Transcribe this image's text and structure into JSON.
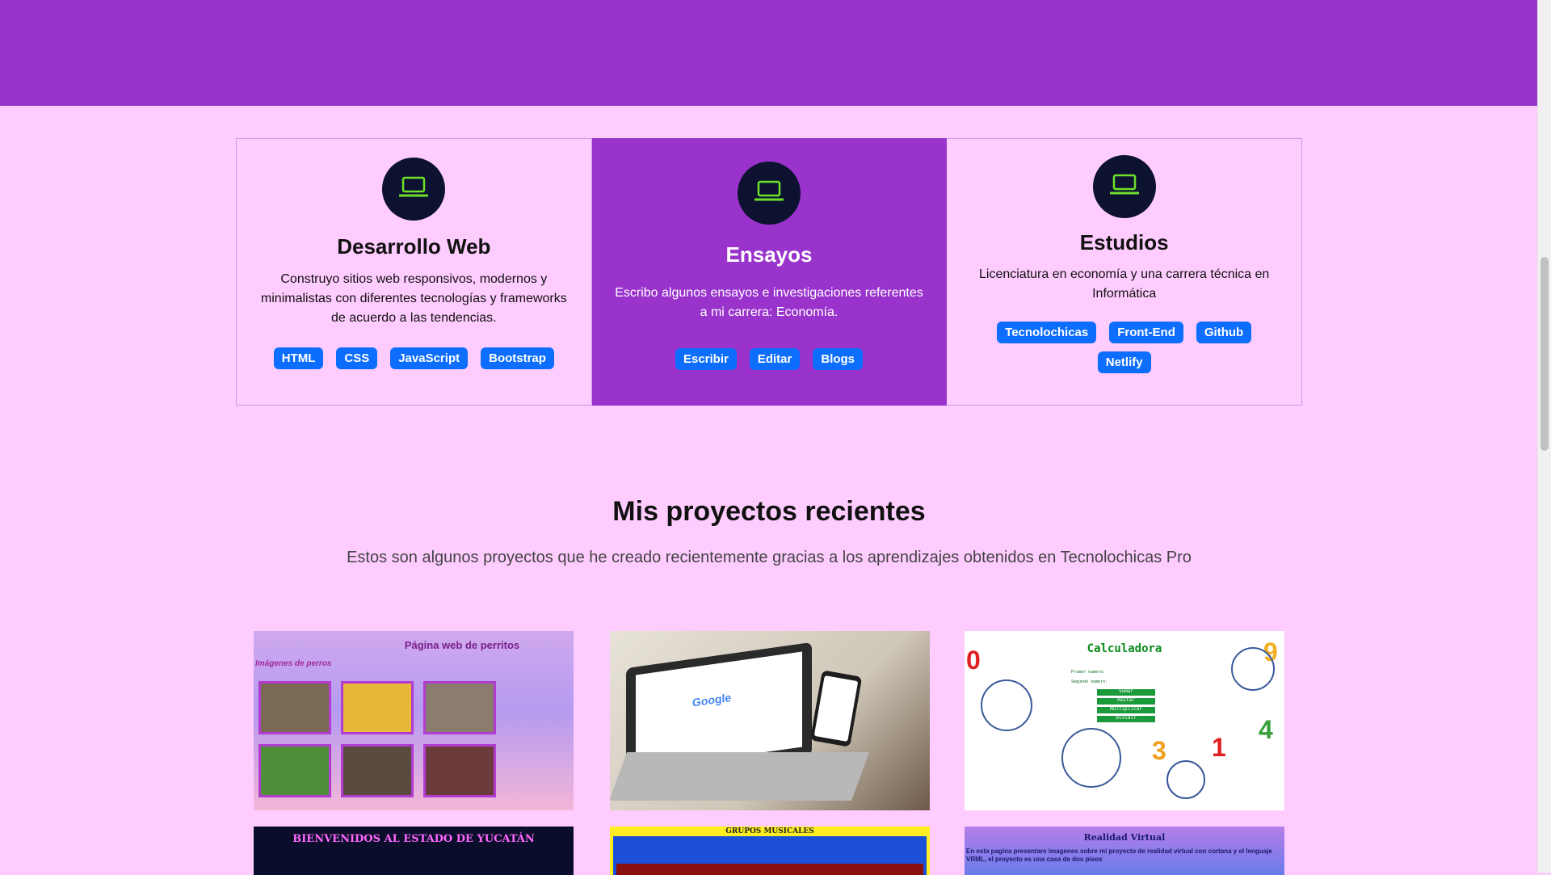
{
  "colors": {
    "accent": "#9933cc",
    "background": "#ffccff",
    "badge": "#0d6efd",
    "icon_circle": "#0c1230",
    "icon_stroke": "#6ee02a"
  },
  "services": [
    {
      "icon": "laptop-icon",
      "title": "Desarrollo Web",
      "description": "Construyo sitios web responsivos, modernos y minimalistas con diferentes tecnologías y frameworks de acuerdo a las tendencias.",
      "badges": [
        "HTML",
        "CSS",
        "JavaScript",
        "Bootstrap"
      ]
    },
    {
      "icon": "laptop-icon",
      "title": "Ensayos",
      "description": "Escribo algunos ensayos e investigaciones referentes a mi carrera: Economía.",
      "badges": [
        "Escribir",
        "Editar",
        "Blogs"
      ]
    },
    {
      "icon": "laptop-icon",
      "title": "Estudios",
      "description": "Licenciatura en economía y una carrera técnica en Informática",
      "badges": [
        "Tecnolochicas",
        "Front-End",
        "Github",
        "Netlify"
      ]
    }
  ],
  "projects": {
    "title": "Mis proyectos recientes",
    "subtitle": "Estos son algunos proyectos que he creado recientemente gracias a los aprendizajes obtenidos en Tecnolochicas Pro",
    "thumbnails": {
      "perritos_title": "Página web de perritos",
      "perritos_sub": "Imágenes de perros",
      "calc_title": "Calculadora",
      "calc_label_1": "Primer numero:",
      "calc_label_2": "Segundo numero:",
      "calc_buttons": [
        "Sumar",
        "Restar",
        "Multiplicar",
        "Dividir"
      ],
      "laptop_logo": "Google",
      "yucatan_title": "BIENVENIDOS AL ESTADO DE YUCATÁN",
      "grupos_title": "GRUPOS MUSICALES",
      "rv_title": "Realidad Virtual",
      "rv_text": "En esta pagina presentare imagenes sobre mi proyecto de realidad virtual con cortana y el lenguaje VRML, el proyecto es una casa de dos pisos"
    }
  }
}
